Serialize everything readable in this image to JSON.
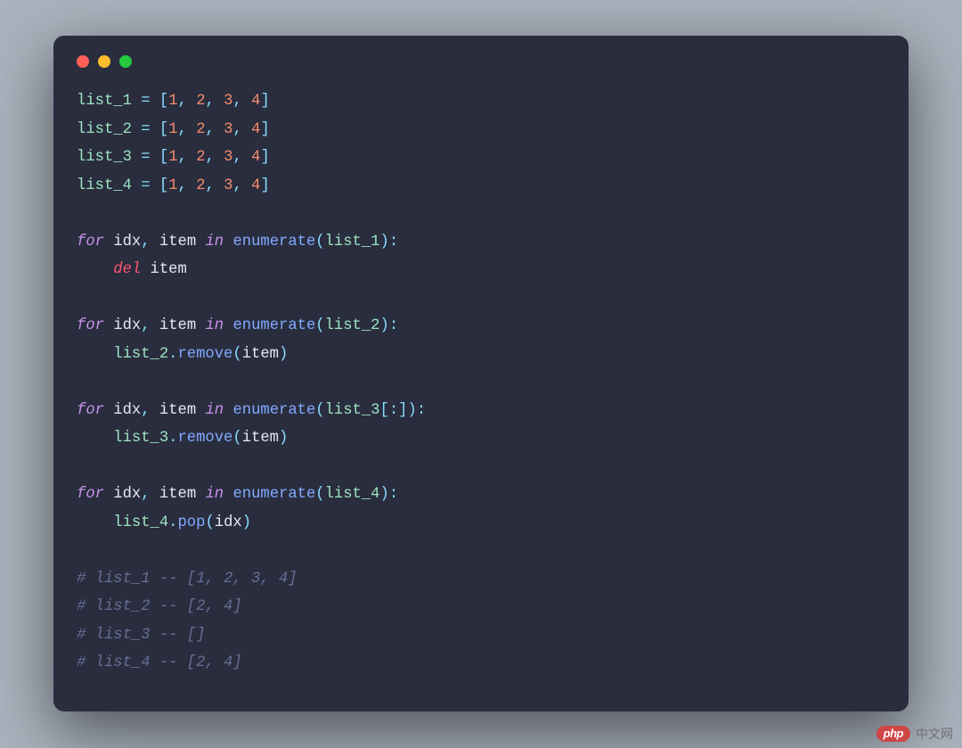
{
  "colors": {
    "page_bg": "#aab2bd",
    "window_bg": "#292d3e",
    "traffic": {
      "red": "#ff5f56",
      "yellow": "#ffbd2e",
      "green": "#27c93f"
    },
    "syntax": {
      "variable": "#9de3c0",
      "operator": "#89ddff",
      "number": "#f78c6c",
      "keyword": "#c792ea",
      "delete": "#ff5572",
      "ident": "#e7e9f0",
      "function": "#82aaff",
      "comment": "#676e95"
    }
  },
  "lines": [
    [
      [
        "var",
        "list_1"
      ],
      [
        "sp",
        " "
      ],
      [
        "op",
        "="
      ],
      [
        "sp",
        " "
      ],
      [
        "op",
        "["
      ],
      [
        "num",
        "1"
      ],
      [
        "op",
        ","
      ],
      [
        "sp",
        " "
      ],
      [
        "num",
        "2"
      ],
      [
        "op",
        ","
      ],
      [
        "sp",
        " "
      ],
      [
        "num",
        "3"
      ],
      [
        "op",
        ","
      ],
      [
        "sp",
        " "
      ],
      [
        "num",
        "4"
      ],
      [
        "op",
        "]"
      ]
    ],
    [
      [
        "var",
        "list_2"
      ],
      [
        "sp",
        " "
      ],
      [
        "op",
        "="
      ],
      [
        "sp",
        " "
      ],
      [
        "op",
        "["
      ],
      [
        "num",
        "1"
      ],
      [
        "op",
        ","
      ],
      [
        "sp",
        " "
      ],
      [
        "num",
        "2"
      ],
      [
        "op",
        ","
      ],
      [
        "sp",
        " "
      ],
      [
        "num",
        "3"
      ],
      [
        "op",
        ","
      ],
      [
        "sp",
        " "
      ],
      [
        "num",
        "4"
      ],
      [
        "op",
        "]"
      ]
    ],
    [
      [
        "var",
        "list_3"
      ],
      [
        "sp",
        " "
      ],
      [
        "op",
        "="
      ],
      [
        "sp",
        " "
      ],
      [
        "op",
        "["
      ],
      [
        "num",
        "1"
      ],
      [
        "op",
        ","
      ],
      [
        "sp",
        " "
      ],
      [
        "num",
        "2"
      ],
      [
        "op",
        ","
      ],
      [
        "sp",
        " "
      ],
      [
        "num",
        "3"
      ],
      [
        "op",
        ","
      ],
      [
        "sp",
        " "
      ],
      [
        "num",
        "4"
      ],
      [
        "op",
        "]"
      ]
    ],
    [
      [
        "var",
        "list_4"
      ],
      [
        "sp",
        " "
      ],
      [
        "op",
        "="
      ],
      [
        "sp",
        " "
      ],
      [
        "op",
        "["
      ],
      [
        "num",
        "1"
      ],
      [
        "op",
        ","
      ],
      [
        "sp",
        " "
      ],
      [
        "num",
        "2"
      ],
      [
        "op",
        ","
      ],
      [
        "sp",
        " "
      ],
      [
        "num",
        "3"
      ],
      [
        "op",
        ","
      ],
      [
        "sp",
        " "
      ],
      [
        "num",
        "4"
      ],
      [
        "op",
        "]"
      ]
    ],
    [],
    [
      [
        "kw",
        "for"
      ],
      [
        "sp",
        " "
      ],
      [
        "ident",
        "idx"
      ],
      [
        "op",
        ","
      ],
      [
        "sp",
        " "
      ],
      [
        "ident",
        "item"
      ],
      [
        "sp",
        " "
      ],
      [
        "kw",
        "in"
      ],
      [
        "sp",
        " "
      ],
      [
        "func",
        "enumerate"
      ],
      [
        "op",
        "("
      ],
      [
        "var",
        "list_1"
      ],
      [
        "op",
        ")"
      ],
      [
        "op",
        ":"
      ]
    ],
    [
      [
        "sp",
        "    "
      ],
      [
        "del",
        "del"
      ],
      [
        "sp",
        " "
      ],
      [
        "ident",
        "item"
      ]
    ],
    [],
    [
      [
        "kw",
        "for"
      ],
      [
        "sp",
        " "
      ],
      [
        "ident",
        "idx"
      ],
      [
        "op",
        ","
      ],
      [
        "sp",
        " "
      ],
      [
        "ident",
        "item"
      ],
      [
        "sp",
        " "
      ],
      [
        "kw",
        "in"
      ],
      [
        "sp",
        " "
      ],
      [
        "func",
        "enumerate"
      ],
      [
        "op",
        "("
      ],
      [
        "var",
        "list_2"
      ],
      [
        "op",
        ")"
      ],
      [
        "op",
        ":"
      ]
    ],
    [
      [
        "sp",
        "    "
      ],
      [
        "var",
        "list_2"
      ],
      [
        "op",
        "."
      ],
      [
        "func",
        "remove"
      ],
      [
        "op",
        "("
      ],
      [
        "ident",
        "item"
      ],
      [
        "op",
        ")"
      ]
    ],
    [],
    [
      [
        "kw",
        "for"
      ],
      [
        "sp",
        " "
      ],
      [
        "ident",
        "idx"
      ],
      [
        "op",
        ","
      ],
      [
        "sp",
        " "
      ],
      [
        "ident",
        "item"
      ],
      [
        "sp",
        " "
      ],
      [
        "kw",
        "in"
      ],
      [
        "sp",
        " "
      ],
      [
        "func",
        "enumerate"
      ],
      [
        "op",
        "("
      ],
      [
        "var",
        "list_3"
      ],
      [
        "op",
        "["
      ],
      [
        "op",
        ":"
      ],
      [
        "op",
        "]"
      ],
      [
        "op",
        ")"
      ],
      [
        "op",
        ":"
      ]
    ],
    [
      [
        "sp",
        "    "
      ],
      [
        "var",
        "list_3"
      ],
      [
        "op",
        "."
      ],
      [
        "func",
        "remove"
      ],
      [
        "op",
        "("
      ],
      [
        "ident",
        "item"
      ],
      [
        "op",
        ")"
      ]
    ],
    [],
    [
      [
        "kw",
        "for"
      ],
      [
        "sp",
        " "
      ],
      [
        "ident",
        "idx"
      ],
      [
        "op",
        ","
      ],
      [
        "sp",
        " "
      ],
      [
        "ident",
        "item"
      ],
      [
        "sp",
        " "
      ],
      [
        "kw",
        "in"
      ],
      [
        "sp",
        " "
      ],
      [
        "func",
        "enumerate"
      ],
      [
        "op",
        "("
      ],
      [
        "var",
        "list_4"
      ],
      [
        "op",
        ")"
      ],
      [
        "op",
        ":"
      ]
    ],
    [
      [
        "sp",
        "    "
      ],
      [
        "var",
        "list_4"
      ],
      [
        "op",
        "."
      ],
      [
        "func",
        "pop"
      ],
      [
        "op",
        "("
      ],
      [
        "ident",
        "idx"
      ],
      [
        "op",
        ")"
      ]
    ],
    [],
    [
      [
        "cmt",
        "# list_1 -- [1, 2, 3, 4]"
      ]
    ],
    [
      [
        "cmt",
        "# list_2 -- [2, 4]"
      ]
    ],
    [
      [
        "cmt",
        "# list_3 -- []"
      ]
    ],
    [
      [
        "cmt",
        "# list_4 -- [2, 4]"
      ]
    ]
  ],
  "watermark": {
    "pill": "php",
    "text": "中文网"
  }
}
